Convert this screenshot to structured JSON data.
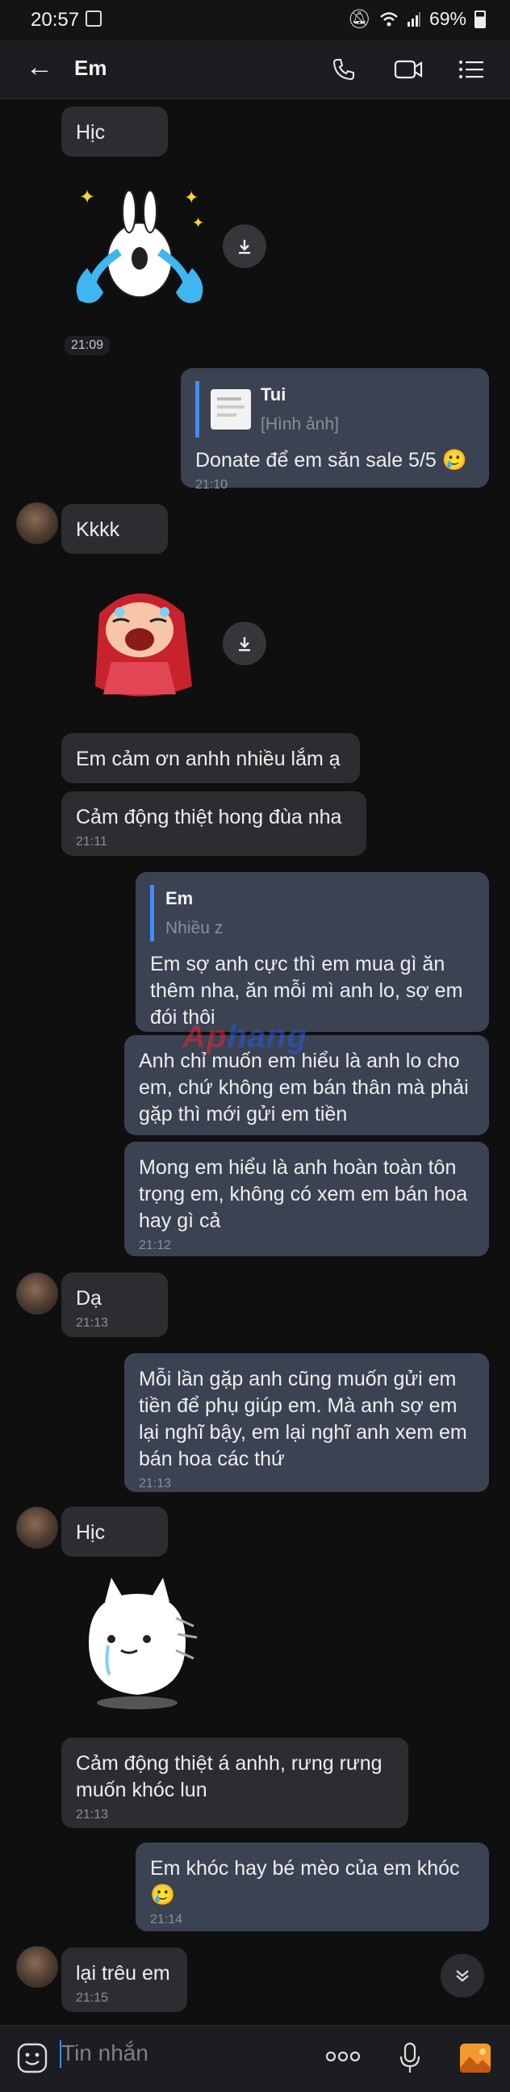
{
  "status": {
    "time": "20:57",
    "battery": "69%"
  },
  "header": {
    "title": "Em"
  },
  "messages": [
    {
      "text": "Hịc"
    },
    {
      "time_badge": "21:09"
    },
    {
      "quote_name": "Tui",
      "quote_text": "[Hình ảnh]",
      "text": "Donate để em săn sale 5/5 🥲",
      "time": "21:10"
    },
    {
      "text": "Kkkk"
    },
    {
      "text": "Em cảm ơn anhh nhiều lắm ạ"
    },
    {
      "text": "Cảm động thiệt hong đùa nha",
      "time": "21:11"
    },
    {
      "quote_name": "Em",
      "quote_text": "Nhiều z",
      "text": "Em sợ anh cực thì em mua gì ăn thêm nha, ăn mỗi mì anh lo, sợ em đói thôi"
    },
    {
      "text": "Anh chỉ muốn em hiểu là anh lo cho em, chứ không em bán thân mà phải gặp thì mới gửi em tiền"
    },
    {
      "text": "Mong em hiểu là anh hoàn toàn tôn trọng em, không có xem em bán hoa hay gì cả",
      "time": "21:12"
    },
    {
      "text": "Dạ",
      "time": "21:13"
    },
    {
      "text": "Mỗi lần gặp anh cũng muốn gửi em tiền để phụ giúp em. Mà anh sợ em lại nghĩ bậy, em lại nghĩ anh xem em bán hoa các thứ",
      "time": "21:13"
    },
    {
      "text": "Hịc"
    },
    {
      "text": "Cảm động thiệt á anhh, rưng rưng muốn khóc lun",
      "time": "21:13"
    },
    {
      "text": "Em khóc hay bé mèo của em khóc 🥲",
      "time": "21:14"
    },
    {
      "text": "lại trêu em",
      "time": "21:15"
    }
  ],
  "watermark": {
    "part1": "Ap",
    "part2": "hang"
  },
  "composer": {
    "placeholder": "Tin nhắn"
  },
  "icons": [
    "back-arrow-icon",
    "phone-icon",
    "video-camera-icon",
    "menu-list-icon",
    "download-icon",
    "chevron-down-icon",
    "emoji-icon",
    "more-dots-icon",
    "microphone-icon",
    "gallery-icon"
  ],
  "colors": {
    "incoming_bubble": "#2c2d31",
    "outgoing_bubble": "#3b4251",
    "accent": "#3c8cff",
    "background": "#0f0f10"
  }
}
